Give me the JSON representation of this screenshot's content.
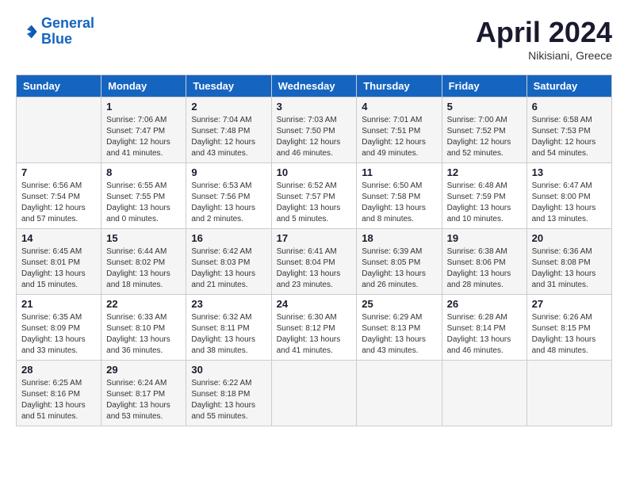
{
  "header": {
    "logo_line1": "General",
    "logo_line2": "Blue",
    "month": "April 2024",
    "location": "Nikisiani, Greece"
  },
  "days_of_week": [
    "Sunday",
    "Monday",
    "Tuesday",
    "Wednesday",
    "Thursday",
    "Friday",
    "Saturday"
  ],
  "weeks": [
    [
      {
        "day": "",
        "sunrise": "",
        "sunset": "",
        "daylight": ""
      },
      {
        "day": "1",
        "sunrise": "Sunrise: 7:06 AM",
        "sunset": "Sunset: 7:47 PM",
        "daylight": "Daylight: 12 hours and 41 minutes."
      },
      {
        "day": "2",
        "sunrise": "Sunrise: 7:04 AM",
        "sunset": "Sunset: 7:48 PM",
        "daylight": "Daylight: 12 hours and 43 minutes."
      },
      {
        "day": "3",
        "sunrise": "Sunrise: 7:03 AM",
        "sunset": "Sunset: 7:50 PM",
        "daylight": "Daylight: 12 hours and 46 minutes."
      },
      {
        "day": "4",
        "sunrise": "Sunrise: 7:01 AM",
        "sunset": "Sunset: 7:51 PM",
        "daylight": "Daylight: 12 hours and 49 minutes."
      },
      {
        "day": "5",
        "sunrise": "Sunrise: 7:00 AM",
        "sunset": "Sunset: 7:52 PM",
        "daylight": "Daylight: 12 hours and 52 minutes."
      },
      {
        "day": "6",
        "sunrise": "Sunrise: 6:58 AM",
        "sunset": "Sunset: 7:53 PM",
        "daylight": "Daylight: 12 hours and 54 minutes."
      }
    ],
    [
      {
        "day": "7",
        "sunrise": "Sunrise: 6:56 AM",
        "sunset": "Sunset: 7:54 PM",
        "daylight": "Daylight: 12 hours and 57 minutes."
      },
      {
        "day": "8",
        "sunrise": "Sunrise: 6:55 AM",
        "sunset": "Sunset: 7:55 PM",
        "daylight": "Daylight: 13 hours and 0 minutes."
      },
      {
        "day": "9",
        "sunrise": "Sunrise: 6:53 AM",
        "sunset": "Sunset: 7:56 PM",
        "daylight": "Daylight: 13 hours and 2 minutes."
      },
      {
        "day": "10",
        "sunrise": "Sunrise: 6:52 AM",
        "sunset": "Sunset: 7:57 PM",
        "daylight": "Daylight: 13 hours and 5 minutes."
      },
      {
        "day": "11",
        "sunrise": "Sunrise: 6:50 AM",
        "sunset": "Sunset: 7:58 PM",
        "daylight": "Daylight: 13 hours and 8 minutes."
      },
      {
        "day": "12",
        "sunrise": "Sunrise: 6:48 AM",
        "sunset": "Sunset: 7:59 PM",
        "daylight": "Daylight: 13 hours and 10 minutes."
      },
      {
        "day": "13",
        "sunrise": "Sunrise: 6:47 AM",
        "sunset": "Sunset: 8:00 PM",
        "daylight": "Daylight: 13 hours and 13 minutes."
      }
    ],
    [
      {
        "day": "14",
        "sunrise": "Sunrise: 6:45 AM",
        "sunset": "Sunset: 8:01 PM",
        "daylight": "Daylight: 13 hours and 15 minutes."
      },
      {
        "day": "15",
        "sunrise": "Sunrise: 6:44 AM",
        "sunset": "Sunset: 8:02 PM",
        "daylight": "Daylight: 13 hours and 18 minutes."
      },
      {
        "day": "16",
        "sunrise": "Sunrise: 6:42 AM",
        "sunset": "Sunset: 8:03 PM",
        "daylight": "Daylight: 13 hours and 21 minutes."
      },
      {
        "day": "17",
        "sunrise": "Sunrise: 6:41 AM",
        "sunset": "Sunset: 8:04 PM",
        "daylight": "Daylight: 13 hours and 23 minutes."
      },
      {
        "day": "18",
        "sunrise": "Sunrise: 6:39 AM",
        "sunset": "Sunset: 8:05 PM",
        "daylight": "Daylight: 13 hours and 26 minutes."
      },
      {
        "day": "19",
        "sunrise": "Sunrise: 6:38 AM",
        "sunset": "Sunset: 8:06 PM",
        "daylight": "Daylight: 13 hours and 28 minutes."
      },
      {
        "day": "20",
        "sunrise": "Sunrise: 6:36 AM",
        "sunset": "Sunset: 8:08 PM",
        "daylight": "Daylight: 13 hours and 31 minutes."
      }
    ],
    [
      {
        "day": "21",
        "sunrise": "Sunrise: 6:35 AM",
        "sunset": "Sunset: 8:09 PM",
        "daylight": "Daylight: 13 hours and 33 minutes."
      },
      {
        "day": "22",
        "sunrise": "Sunrise: 6:33 AM",
        "sunset": "Sunset: 8:10 PM",
        "daylight": "Daylight: 13 hours and 36 minutes."
      },
      {
        "day": "23",
        "sunrise": "Sunrise: 6:32 AM",
        "sunset": "Sunset: 8:11 PM",
        "daylight": "Daylight: 13 hours and 38 minutes."
      },
      {
        "day": "24",
        "sunrise": "Sunrise: 6:30 AM",
        "sunset": "Sunset: 8:12 PM",
        "daylight": "Daylight: 13 hours and 41 minutes."
      },
      {
        "day": "25",
        "sunrise": "Sunrise: 6:29 AM",
        "sunset": "Sunset: 8:13 PM",
        "daylight": "Daylight: 13 hours and 43 minutes."
      },
      {
        "day": "26",
        "sunrise": "Sunrise: 6:28 AM",
        "sunset": "Sunset: 8:14 PM",
        "daylight": "Daylight: 13 hours and 46 minutes."
      },
      {
        "day": "27",
        "sunrise": "Sunrise: 6:26 AM",
        "sunset": "Sunset: 8:15 PM",
        "daylight": "Daylight: 13 hours and 48 minutes."
      }
    ],
    [
      {
        "day": "28",
        "sunrise": "Sunrise: 6:25 AM",
        "sunset": "Sunset: 8:16 PM",
        "daylight": "Daylight: 13 hours and 51 minutes."
      },
      {
        "day": "29",
        "sunrise": "Sunrise: 6:24 AM",
        "sunset": "Sunset: 8:17 PM",
        "daylight": "Daylight: 13 hours and 53 minutes."
      },
      {
        "day": "30",
        "sunrise": "Sunrise: 6:22 AM",
        "sunset": "Sunset: 8:18 PM",
        "daylight": "Daylight: 13 hours and 55 minutes."
      },
      {
        "day": "",
        "sunrise": "",
        "sunset": "",
        "daylight": ""
      },
      {
        "day": "",
        "sunrise": "",
        "sunset": "",
        "daylight": ""
      },
      {
        "day": "",
        "sunrise": "",
        "sunset": "",
        "daylight": ""
      },
      {
        "day": "",
        "sunrise": "",
        "sunset": "",
        "daylight": ""
      }
    ]
  ]
}
